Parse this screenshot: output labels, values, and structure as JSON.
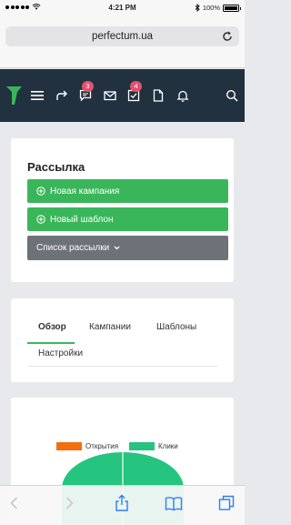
{
  "status_bar": {
    "time": "4:21 PM",
    "battery": "100%"
  },
  "browser": {
    "url": "perfectum.ua"
  },
  "nav": {
    "messages_badge": "3",
    "tasks_badge": "4"
  },
  "mailing": {
    "title": "Рассылка",
    "buttons": {
      "new_campaign": "Новая кампания",
      "new_template": "Новый шаблон",
      "mailing_list": "Список рассылки"
    }
  },
  "tabs": [
    {
      "label": "Обзор",
      "active": true
    },
    {
      "label": "Кампании",
      "active": false
    },
    {
      "label": "Шаблоны",
      "active": false
    },
    {
      "label": "Настройки",
      "active": false
    }
  ],
  "chart": {
    "legend": [
      {
        "label": "Открытия",
        "color": "#f07010"
      },
      {
        "label": "Клики",
        "color": "#25c47f"
      }
    ]
  },
  "colors": {
    "nav_bg": "#22313f",
    "accent_green": "#3ab65a",
    "badge": "#e2526f",
    "ios_blue": "#2f7cf6"
  },
  "icons": [
    "signal-dots-icon",
    "wifi-icon",
    "bluetooth-icon",
    "battery-icon",
    "reload-icon",
    "logo-icon",
    "hamburger-icon",
    "share-arrow-icon",
    "chat-icon",
    "mail-icon",
    "tasks-icon",
    "document-icon",
    "bell-icon",
    "search-icon",
    "back-icon",
    "forward-icon",
    "share-icon",
    "bookmarks-icon",
    "tabs-icon"
  ]
}
